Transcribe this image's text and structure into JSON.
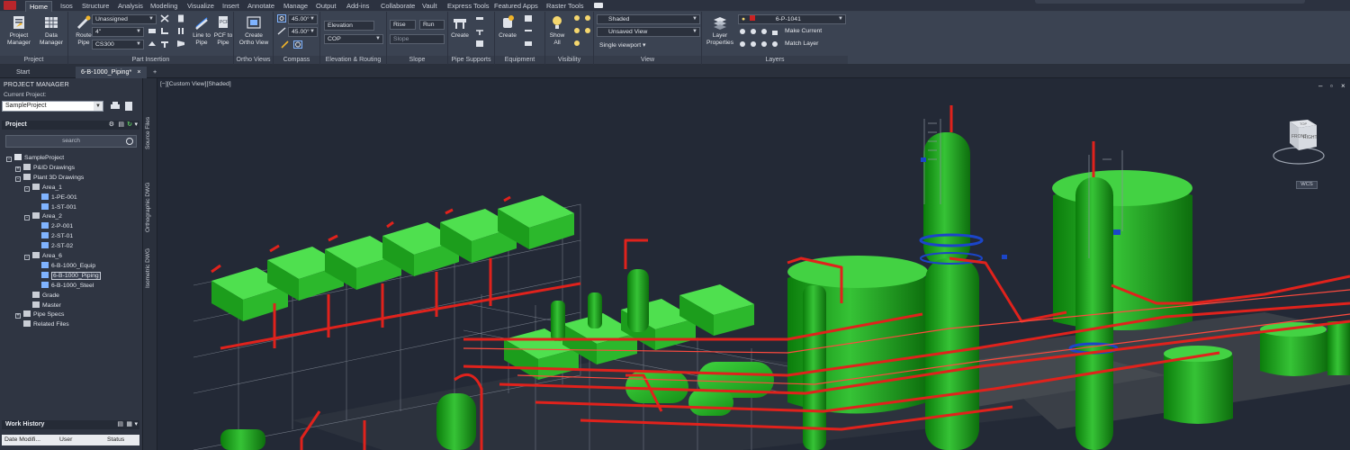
{
  "menubar": {
    "tabs": [
      "Home",
      "Isos",
      "Structure",
      "Analysis",
      "Modeling",
      "Visualize",
      "Insert",
      "Annotate",
      "Manage",
      "Output",
      "Add-ins",
      "Collaborate",
      "Vault",
      "Express Tools",
      "Featured Apps",
      "Raster Tools"
    ],
    "active_tab": "Home"
  },
  "ribbon": {
    "project": {
      "title": "Project",
      "project_manager": "Project\nManager",
      "data_manager": "Data\nManager"
    },
    "part_insertion": {
      "title": "Part Insertion",
      "route_pipe": "Route\nPipe",
      "line_to_pipe": "Line to\nPipe",
      "pcf_to_pipe": "PCF to\nPipe",
      "service_value": "Unassigned",
      "size_value": "4\"",
      "spec_value": "CS300"
    },
    "ortho_views": {
      "title": "Ortho Views",
      "create_ortho_view": "Create\nOrtho View"
    },
    "compass": {
      "title": "Compass",
      "angle1": "45.00°",
      "angle2": "45.00°"
    },
    "elevation_routing": {
      "title": "Elevation & Routing",
      "elevation_label": "Elevation",
      "cop_value": "COP"
    },
    "slope": {
      "title": "Slope",
      "rise": "Rise",
      "run": "Run",
      "slope_field": "Slope"
    },
    "pipe_supports": {
      "title": "Pipe Supports",
      "create": "Create"
    },
    "equipment": {
      "title": "Equipment",
      "create": "Create"
    },
    "visibility": {
      "title": "Visibility",
      "show_all": "Show\nAll"
    },
    "view": {
      "title": "View",
      "visual_style": "Shaded",
      "named_view": "Unsaved View",
      "viewport_config": "Single viewport"
    },
    "layers": {
      "title": "Layers",
      "layer_properties": "Layer\nProperties",
      "current_layer": "6-P-1041",
      "make_current": "Make Current",
      "match_layer": "Match Layer",
      "layer_color": "#cc2222"
    }
  },
  "doc_tabs": {
    "start": "Start",
    "active": "6-B-1000_Piping*",
    "add": "+"
  },
  "palette": {
    "title": "PROJECT MANAGER",
    "current_project_label": "Current Project:",
    "current_project_value": "SampleProject",
    "project_section": "Project",
    "search_placeholder": "search",
    "tree": [
      {
        "label": "SampleProject",
        "level": 0,
        "toggle": "-"
      },
      {
        "label": "P&ID Drawings",
        "level": 1,
        "toggle": "+"
      },
      {
        "label": "Plant 3D Drawings",
        "level": 1,
        "toggle": "-"
      },
      {
        "label": "Area_1",
        "level": 2,
        "toggle": "-"
      },
      {
        "label": "1-PE-001",
        "level": 3,
        "toggle": ""
      },
      {
        "label": "1-ST-001",
        "level": 3,
        "toggle": ""
      },
      {
        "label": "Area_2",
        "level": 2,
        "toggle": "-"
      },
      {
        "label": "2-P-001",
        "level": 3,
        "toggle": ""
      },
      {
        "label": "2-ST-01",
        "level": 3,
        "toggle": ""
      },
      {
        "label": "2-ST-02",
        "level": 3,
        "toggle": ""
      },
      {
        "label": "Area_6",
        "level": 2,
        "toggle": "-"
      },
      {
        "label": "6-B-1000_Equip",
        "level": 3,
        "toggle": ""
      },
      {
        "label": "6-B-1000_Piping",
        "level": 3,
        "toggle": "",
        "selected": true
      },
      {
        "label": "6-B-1000_Steel",
        "level": 3,
        "toggle": ""
      },
      {
        "label": "Grade",
        "level": 2,
        "toggle": ""
      },
      {
        "label": "Master",
        "level": 2,
        "toggle": ""
      },
      {
        "label": "Pipe Specs",
        "level": 1,
        "toggle": "+"
      },
      {
        "label": "Related Files",
        "level": 1,
        "toggle": ""
      }
    ],
    "side_tabs": [
      "Source Files",
      "Orthographic DWG",
      "Isometric DWG"
    ],
    "work_history": {
      "title": "Work History",
      "columns": [
        "Date Modifi...",
        "User",
        "Status"
      ]
    }
  },
  "viewport": {
    "label": "[−][Custom View][Shaded]",
    "cube_top": "TOP",
    "cube_front": "FRONT",
    "cube_right": "RIGHT",
    "wcs": "WCS"
  }
}
